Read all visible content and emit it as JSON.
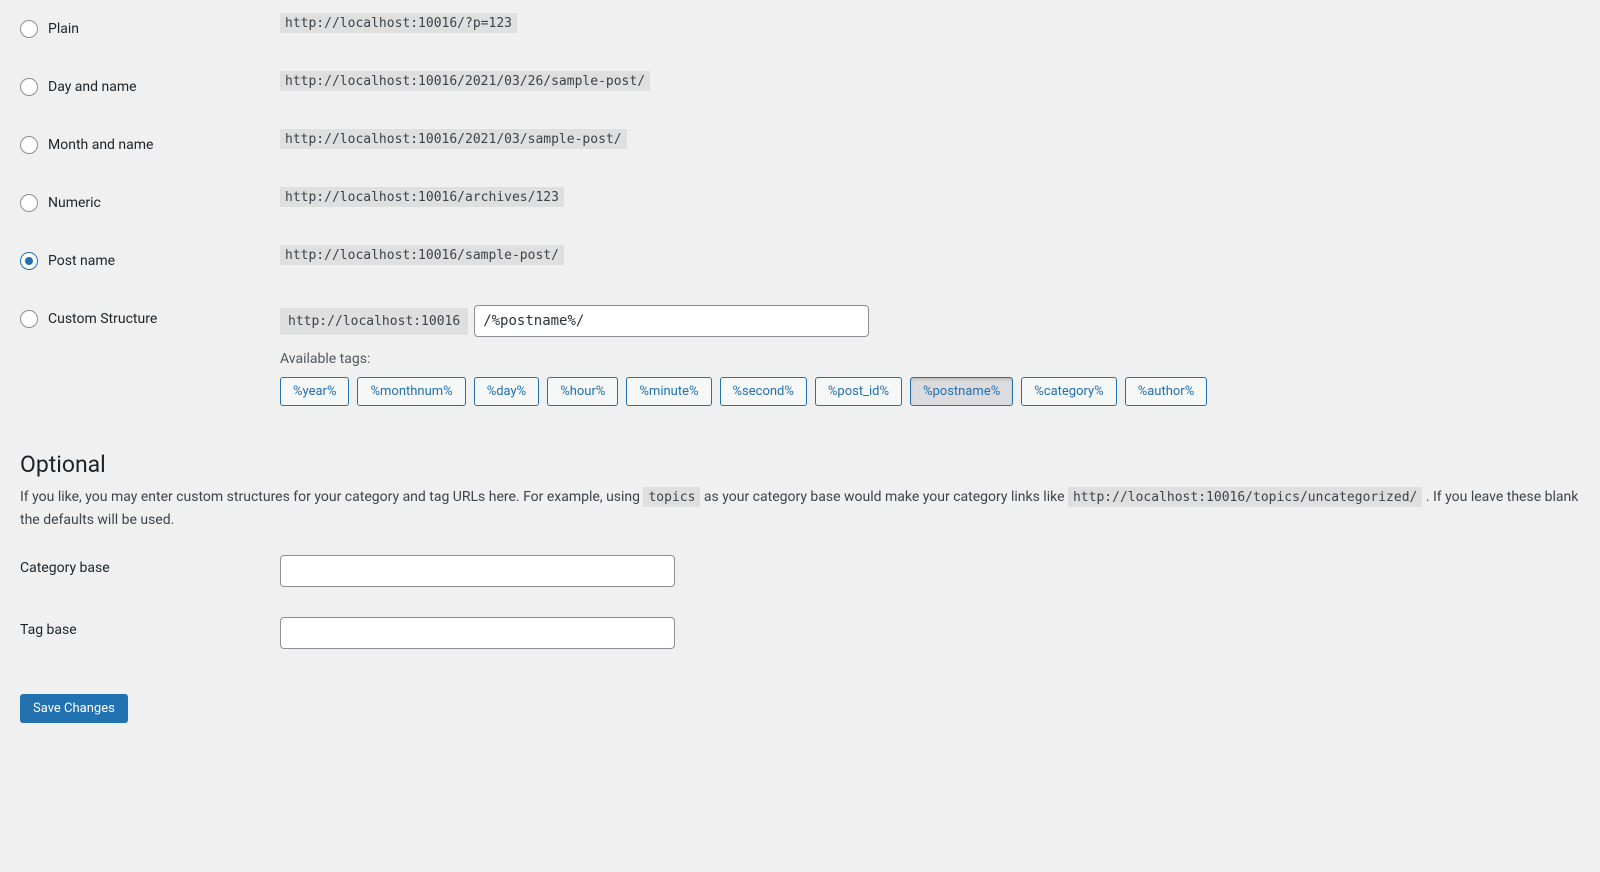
{
  "permalinks": {
    "options": [
      {
        "label": "Plain",
        "example": "http://localhost:10016/?p=123"
      },
      {
        "label": "Day and name",
        "example": "http://localhost:10016/2021/03/26/sample-post/"
      },
      {
        "label": "Month and name",
        "example": "http://localhost:10016/2021/03/sample-post/"
      },
      {
        "label": "Numeric",
        "example": "http://localhost:10016/archives/123"
      },
      {
        "label": "Post name",
        "example": "http://localhost:10016/sample-post/"
      }
    ],
    "custom": {
      "label": "Custom Structure",
      "base_url": "http://localhost:10016",
      "value": "/%postname%/",
      "available_label": "Available tags:",
      "tags": [
        "%year%",
        "%monthnum%",
        "%day%",
        "%hour%",
        "%minute%",
        "%second%",
        "%post_id%",
        "%postname%",
        "%category%",
        "%author%"
      ],
      "active_tag": "%postname%"
    }
  },
  "optional": {
    "heading": "Optional",
    "desc_1": "If you like, you may enter custom structures for your category and tag URLs here. For example, using ",
    "desc_code1": "topics",
    "desc_2": " as your category base would make your category links like ",
    "desc_code2": "http://localhost:10016/topics/uncategorized/",
    "desc_3": " . If you leave these blank the defaults will be used.",
    "category_label": "Category base",
    "category_value": "",
    "tag_label": "Tag base",
    "tag_value": ""
  },
  "submit_label": "Save Changes"
}
